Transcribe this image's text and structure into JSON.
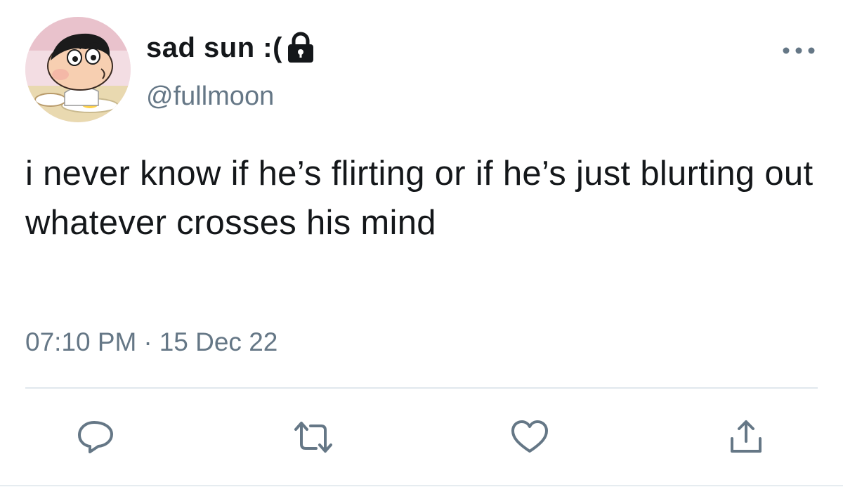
{
  "tweet": {
    "author": {
      "display_name": "sad sun :(",
      "handle": "@fullmoon",
      "avatar_icon": "cartoon-avatar",
      "protected_icon": "lock-icon"
    },
    "text": "i never know if he’s flirting or if he’s just blurting out whatever crosses his mind",
    "time": "07:10 PM",
    "separator": "·",
    "date": "15 Dec 22"
  },
  "actions": {
    "reply_icon": "reply-icon",
    "retweet_icon": "retweet-icon",
    "like_icon": "heart-icon",
    "share_icon": "share-icon",
    "more_icon": "more-options-icon"
  },
  "colors": {
    "text": "#14171a",
    "secondary": "#657786",
    "divider": "#e1e8ed"
  }
}
